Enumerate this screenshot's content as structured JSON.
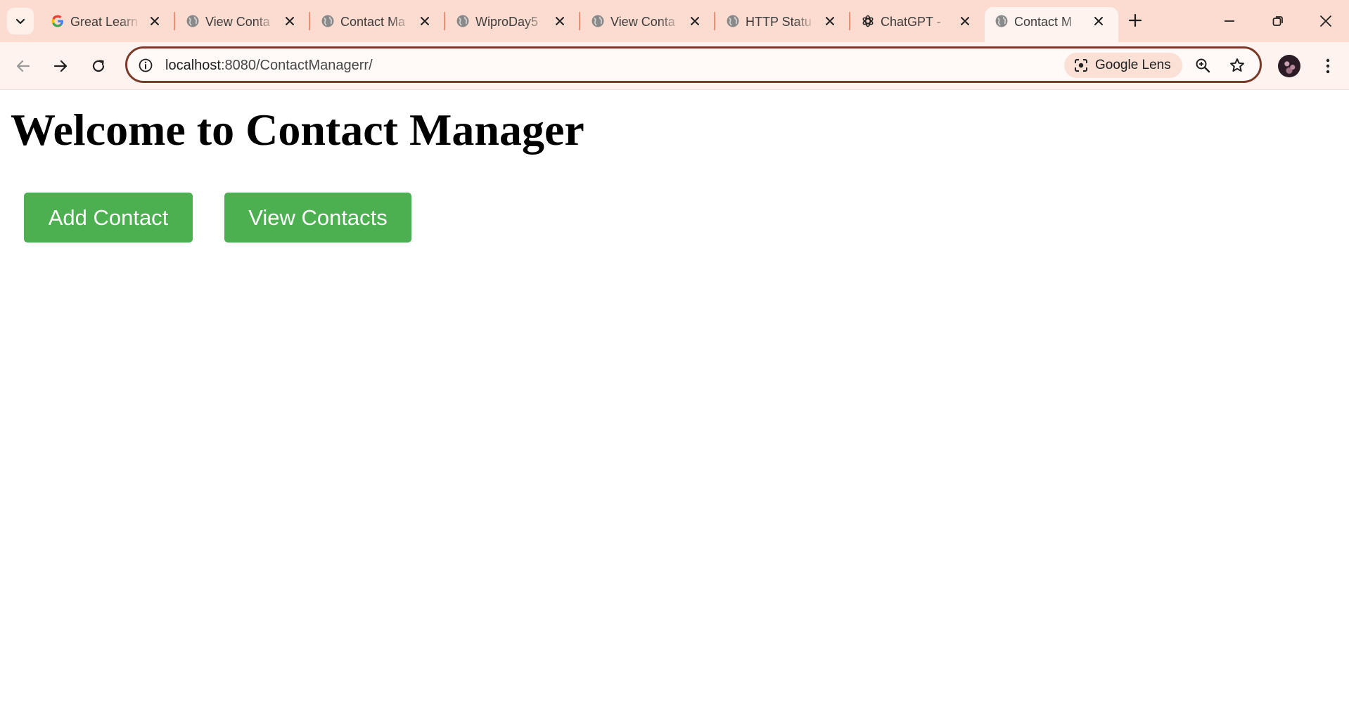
{
  "browser": {
    "tabs": [
      {
        "title": "Great Learn",
        "favicon": "google-icon",
        "active": false
      },
      {
        "title": "View Conta",
        "favicon": "globe-icon",
        "active": false
      },
      {
        "title": "Contact Ma",
        "favicon": "globe-icon",
        "active": false
      },
      {
        "title": "WiproDay5",
        "favicon": "globe-icon",
        "active": false
      },
      {
        "title": "View Conta",
        "favicon": "globe-icon",
        "active": false
      },
      {
        "title": "HTTP Statu",
        "favicon": "globe-icon",
        "active": false
      },
      {
        "title": "ChatGPT -",
        "favicon": "chatgpt-icon",
        "active": false
      },
      {
        "title": "Contact M",
        "favicon": "globe-icon",
        "active": true
      }
    ],
    "address_bar": {
      "host": "localhost",
      "path": ":8080/ContactManagerr/"
    },
    "lens_label": "Google Lens",
    "colors": {
      "tabstrip_bg": "#fcdcd0",
      "toolbar_bg": "#fff3ef",
      "omnibox_border": "#7a3a2a",
      "tab_separator": "#f08f76"
    }
  },
  "page": {
    "title": "Welcome to Contact Manager",
    "buttons": {
      "add_contact": "Add Contact",
      "view_contacts": "View Contacts"
    },
    "colors": {
      "button_bg": "#4caf50",
      "button_text": "#ffffff"
    }
  }
}
